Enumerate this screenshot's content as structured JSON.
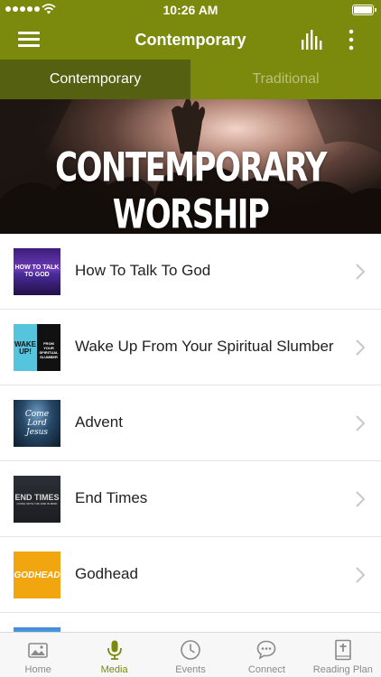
{
  "status_bar": {
    "time": "10:26 AM"
  },
  "nav": {
    "title": "Contemporary"
  },
  "tabs": [
    {
      "label": "Contemporary",
      "active": true
    },
    {
      "label": "Traditional",
      "active": false
    }
  ],
  "banner": {
    "headline": "CONTEMPORARY WORSHIP"
  },
  "items": [
    {
      "title": "How To Talk To God",
      "thumb_text": "HOW TO TALK TO GOD"
    },
    {
      "title": "Wake Up From Your Spiritual Slumber",
      "thumb_text": "WAKE UP!",
      "thumb_text_2": "FROM YOUR SPIRITUAL SLUMBER"
    },
    {
      "title": "Advent",
      "thumb_text": "Come Lord Jesus"
    },
    {
      "title": "End Times",
      "thumb_text": "END TIMES",
      "thumb_text_2": "LIVING WITH THE END IN MIND"
    },
    {
      "title": "Godhead",
      "thumb_text": "GODHEAD"
    },
    {
      "title": ""
    }
  ],
  "tab_bar": [
    {
      "label": "Home",
      "icon": "image-icon"
    },
    {
      "label": "Media",
      "icon": "microphone-icon",
      "active": true
    },
    {
      "label": "Events",
      "icon": "clock-icon"
    },
    {
      "label": "Connect",
      "icon": "chat-bubble-icon"
    },
    {
      "label": "Reading Plan",
      "icon": "bible-icon"
    }
  ],
  "colors": {
    "primary": "#7b8a0d",
    "tab_active": "#556010",
    "tab_inactive_text": "#b9c27a"
  }
}
